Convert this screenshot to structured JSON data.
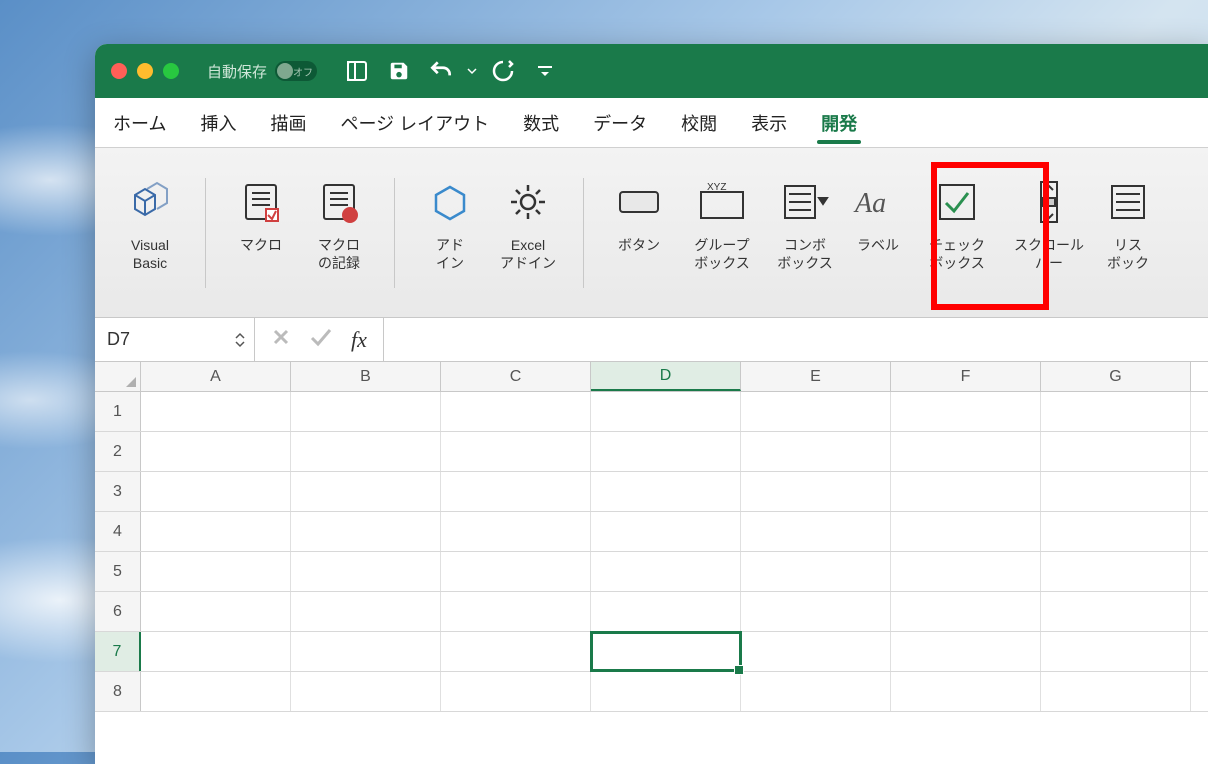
{
  "autosave": {
    "label": "自動保存",
    "state": "オフ"
  },
  "tabs": [
    {
      "label": "ホーム"
    },
    {
      "label": "挿入"
    },
    {
      "label": "描画"
    },
    {
      "label": "ページ レイアウト"
    },
    {
      "label": "数式"
    },
    {
      "label": "データ"
    },
    {
      "label": "校閲"
    },
    {
      "label": "表示"
    },
    {
      "label": "開発",
      "active": true
    }
  ],
  "ribbon": {
    "visual_basic": "Visual\nBasic",
    "macros": "マクロ",
    "record_macro": "マクロ\nの記録",
    "addins": "アド\nイン",
    "excel_addins": "Excel\nアドイン",
    "button": "ボタン",
    "group_box": "グループ\nボックス",
    "combo_box": "コンボ\nボックス",
    "label": "ラベル",
    "checkbox": "チェック\nボックス",
    "scrollbar": "スクロール\nバー",
    "listbox": "リス\nボック"
  },
  "formula": {
    "name_box": "D7",
    "fx": ""
  },
  "sheet": {
    "cols": [
      "A",
      "B",
      "C",
      "D",
      "E",
      "F",
      "G"
    ],
    "rows": [
      "1",
      "2",
      "3",
      "4",
      "5",
      "6",
      "7",
      "8"
    ],
    "active_col": "D",
    "active_row": "7"
  },
  "highlight_target": "checkbox"
}
